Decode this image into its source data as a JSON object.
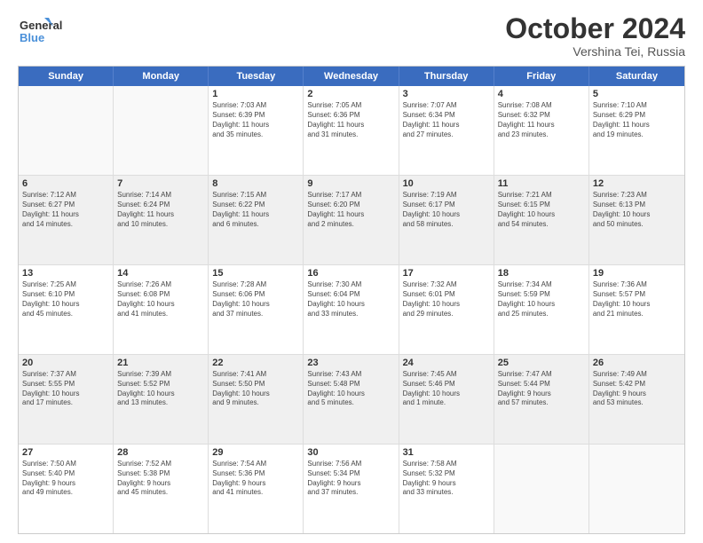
{
  "header": {
    "logo_line1": "General",
    "logo_line2": "Blue",
    "month": "October 2024",
    "location": "Vershina Tei, Russia"
  },
  "days_of_week": [
    "Sunday",
    "Monday",
    "Tuesday",
    "Wednesday",
    "Thursday",
    "Friday",
    "Saturday"
  ],
  "rows": [
    [
      {
        "day": "",
        "lines": []
      },
      {
        "day": "",
        "lines": []
      },
      {
        "day": "1",
        "lines": [
          "Sunrise: 7:03 AM",
          "Sunset: 6:39 PM",
          "Daylight: 11 hours",
          "and 35 minutes."
        ]
      },
      {
        "day": "2",
        "lines": [
          "Sunrise: 7:05 AM",
          "Sunset: 6:36 PM",
          "Daylight: 11 hours",
          "and 31 minutes."
        ]
      },
      {
        "day": "3",
        "lines": [
          "Sunrise: 7:07 AM",
          "Sunset: 6:34 PM",
          "Daylight: 11 hours",
          "and 27 minutes."
        ]
      },
      {
        "day": "4",
        "lines": [
          "Sunrise: 7:08 AM",
          "Sunset: 6:32 PM",
          "Daylight: 11 hours",
          "and 23 minutes."
        ]
      },
      {
        "day": "5",
        "lines": [
          "Sunrise: 7:10 AM",
          "Sunset: 6:29 PM",
          "Daylight: 11 hours",
          "and 19 minutes."
        ]
      }
    ],
    [
      {
        "day": "6",
        "lines": [
          "Sunrise: 7:12 AM",
          "Sunset: 6:27 PM",
          "Daylight: 11 hours",
          "and 14 minutes."
        ]
      },
      {
        "day": "7",
        "lines": [
          "Sunrise: 7:14 AM",
          "Sunset: 6:24 PM",
          "Daylight: 11 hours",
          "and 10 minutes."
        ]
      },
      {
        "day": "8",
        "lines": [
          "Sunrise: 7:15 AM",
          "Sunset: 6:22 PM",
          "Daylight: 11 hours",
          "and 6 minutes."
        ]
      },
      {
        "day": "9",
        "lines": [
          "Sunrise: 7:17 AM",
          "Sunset: 6:20 PM",
          "Daylight: 11 hours",
          "and 2 minutes."
        ]
      },
      {
        "day": "10",
        "lines": [
          "Sunrise: 7:19 AM",
          "Sunset: 6:17 PM",
          "Daylight: 10 hours",
          "and 58 minutes."
        ]
      },
      {
        "day": "11",
        "lines": [
          "Sunrise: 7:21 AM",
          "Sunset: 6:15 PM",
          "Daylight: 10 hours",
          "and 54 minutes."
        ]
      },
      {
        "day": "12",
        "lines": [
          "Sunrise: 7:23 AM",
          "Sunset: 6:13 PM",
          "Daylight: 10 hours",
          "and 50 minutes."
        ]
      }
    ],
    [
      {
        "day": "13",
        "lines": [
          "Sunrise: 7:25 AM",
          "Sunset: 6:10 PM",
          "Daylight: 10 hours",
          "and 45 minutes."
        ]
      },
      {
        "day": "14",
        "lines": [
          "Sunrise: 7:26 AM",
          "Sunset: 6:08 PM",
          "Daylight: 10 hours",
          "and 41 minutes."
        ]
      },
      {
        "day": "15",
        "lines": [
          "Sunrise: 7:28 AM",
          "Sunset: 6:06 PM",
          "Daylight: 10 hours",
          "and 37 minutes."
        ]
      },
      {
        "day": "16",
        "lines": [
          "Sunrise: 7:30 AM",
          "Sunset: 6:04 PM",
          "Daylight: 10 hours",
          "and 33 minutes."
        ]
      },
      {
        "day": "17",
        "lines": [
          "Sunrise: 7:32 AM",
          "Sunset: 6:01 PM",
          "Daylight: 10 hours",
          "and 29 minutes."
        ]
      },
      {
        "day": "18",
        "lines": [
          "Sunrise: 7:34 AM",
          "Sunset: 5:59 PM",
          "Daylight: 10 hours",
          "and 25 minutes."
        ]
      },
      {
        "day": "19",
        "lines": [
          "Sunrise: 7:36 AM",
          "Sunset: 5:57 PM",
          "Daylight: 10 hours",
          "and 21 minutes."
        ]
      }
    ],
    [
      {
        "day": "20",
        "lines": [
          "Sunrise: 7:37 AM",
          "Sunset: 5:55 PM",
          "Daylight: 10 hours",
          "and 17 minutes."
        ]
      },
      {
        "day": "21",
        "lines": [
          "Sunrise: 7:39 AM",
          "Sunset: 5:52 PM",
          "Daylight: 10 hours",
          "and 13 minutes."
        ]
      },
      {
        "day": "22",
        "lines": [
          "Sunrise: 7:41 AM",
          "Sunset: 5:50 PM",
          "Daylight: 10 hours",
          "and 9 minutes."
        ]
      },
      {
        "day": "23",
        "lines": [
          "Sunrise: 7:43 AM",
          "Sunset: 5:48 PM",
          "Daylight: 10 hours",
          "and 5 minutes."
        ]
      },
      {
        "day": "24",
        "lines": [
          "Sunrise: 7:45 AM",
          "Sunset: 5:46 PM",
          "Daylight: 10 hours",
          "and 1 minute."
        ]
      },
      {
        "day": "25",
        "lines": [
          "Sunrise: 7:47 AM",
          "Sunset: 5:44 PM",
          "Daylight: 9 hours",
          "and 57 minutes."
        ]
      },
      {
        "day": "26",
        "lines": [
          "Sunrise: 7:49 AM",
          "Sunset: 5:42 PM",
          "Daylight: 9 hours",
          "and 53 minutes."
        ]
      }
    ],
    [
      {
        "day": "27",
        "lines": [
          "Sunrise: 7:50 AM",
          "Sunset: 5:40 PM",
          "Daylight: 9 hours",
          "and 49 minutes."
        ]
      },
      {
        "day": "28",
        "lines": [
          "Sunrise: 7:52 AM",
          "Sunset: 5:38 PM",
          "Daylight: 9 hours",
          "and 45 minutes."
        ]
      },
      {
        "day": "29",
        "lines": [
          "Sunrise: 7:54 AM",
          "Sunset: 5:36 PM",
          "Daylight: 9 hours",
          "and 41 minutes."
        ]
      },
      {
        "day": "30",
        "lines": [
          "Sunrise: 7:56 AM",
          "Sunset: 5:34 PM",
          "Daylight: 9 hours",
          "and 37 minutes."
        ]
      },
      {
        "day": "31",
        "lines": [
          "Sunrise: 7:58 AM",
          "Sunset: 5:32 PM",
          "Daylight: 9 hours",
          "and 33 minutes."
        ]
      },
      {
        "day": "",
        "lines": []
      },
      {
        "day": "",
        "lines": []
      }
    ]
  ]
}
